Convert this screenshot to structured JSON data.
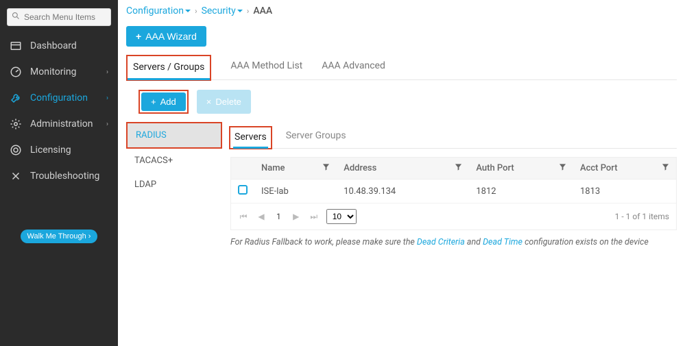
{
  "search": {
    "placeholder": "Search Menu Items"
  },
  "nav": {
    "dashboard": "Dashboard",
    "monitoring": "Monitoring",
    "configuration": "Configuration",
    "administration": "Administration",
    "licensing": "Licensing",
    "troubleshooting": "Troubleshooting"
  },
  "walk_btn": "Walk Me Through ›",
  "breadcrumb": {
    "l1": "Configuration",
    "l2": "Security",
    "l3": "AAA"
  },
  "wizard_btn": "AAA Wizard",
  "tabs1": {
    "t0": "Servers / Groups",
    "t1": "AAA Method List",
    "t2": "AAA Advanced"
  },
  "buttons": {
    "add": "Add",
    "del": "Delete"
  },
  "protocols": {
    "radius": "RADIUS",
    "tacacs": "TACACS+",
    "ldap": "LDAP"
  },
  "subtabs": {
    "servers": "Servers",
    "groups": "Server Groups"
  },
  "table": {
    "headers": {
      "name": "Name",
      "address": "Address",
      "auth": "Auth Port",
      "acct": "Acct Port"
    },
    "rows": [
      {
        "name": "ISE-lab",
        "address": "10.48.39.134",
        "auth": "1812",
        "acct": "1813"
      }
    ]
  },
  "pager": {
    "page": "1",
    "size": "10",
    "summary": "1 - 1 of 1 items"
  },
  "notice": {
    "pre": "For Radius Fallback to work, please make sure the ",
    "link1": "Dead Criteria",
    "mid": " and ",
    "link2": "Dead Time",
    "post": " configuration exists on the device"
  }
}
